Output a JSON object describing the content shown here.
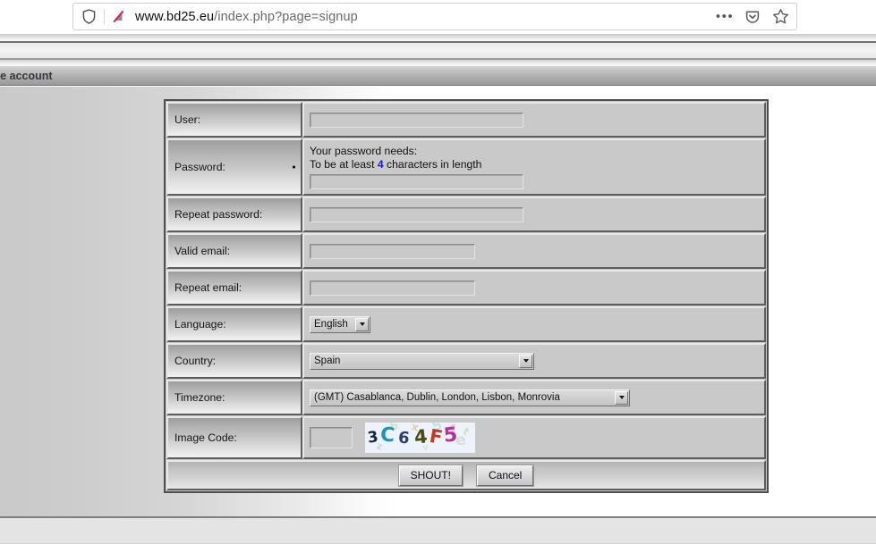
{
  "browser": {
    "url_domain": "www.bd25.eu",
    "url_path": "/index.php?page=signup",
    "url_full": "www.bd25.eu/index.php?page=signup",
    "icons": {
      "shield": "shield-icon",
      "permission_blocked": "blocked-permission-icon",
      "more": "ellipsis-icon",
      "pocket": "pocket-save-icon",
      "bookmark": "star-bookmark-icon"
    },
    "dots_glyph": "•••"
  },
  "page": {
    "header_title": "te account"
  },
  "form": {
    "rows": [
      {
        "label": "User:",
        "type": "text",
        "value": "",
        "required": false
      },
      {
        "label": "Password:",
        "type": "password_hint",
        "value": "",
        "required": true
      },
      {
        "label": "Repeat password:",
        "type": "text",
        "value": "",
        "required": false
      },
      {
        "label": "Valid email:",
        "type": "text",
        "value": "",
        "required": false
      },
      {
        "label": "Repeat email:",
        "type": "text",
        "value": "",
        "required": false
      },
      {
        "label": "Language:",
        "type": "select",
        "value": "English",
        "required": false
      },
      {
        "label": "Country:",
        "type": "select",
        "value": "Spain",
        "required": false
      },
      {
        "label": "Timezone:",
        "type": "select",
        "value": "(GMT) Casablanca, Dublin, London, Lisbon, Monrovia",
        "required": false
      },
      {
        "label": "Image Code:",
        "type": "captcha",
        "value": "",
        "required": false
      }
    ],
    "password_hint": {
      "line1": "Your password needs:",
      "line2_before": "To be at least ",
      "line2_number": "4",
      "line2_after": " characters in length"
    },
    "labels": {
      "user": "User:",
      "password": "Password:",
      "repeat_password": "Repeat password:",
      "valid_email": "Valid email:",
      "repeat_email": "Repeat email:",
      "language": "Language:",
      "country": "Country:",
      "timezone": "Timezone:",
      "image_code": "Image Code:"
    },
    "values": {
      "user": "",
      "password": "",
      "repeat_password": "",
      "valid_email": "",
      "repeat_email": "",
      "language": "English",
      "country": "Spain",
      "timezone": "(GMT) Casablanca, Dublin, London, Lisbon, Monrovia",
      "image_code": ""
    },
    "captcha": {
      "text": "3C64F5",
      "characters": [
        {
          "ch": "3",
          "color": "#15254a"
        },
        {
          "ch": "C",
          "color": "#1e93b8"
        },
        {
          "ch": "6",
          "color": "#2d3f6e"
        },
        {
          "ch": "4",
          "color": "#4a4a14"
        },
        {
          "ch": "F",
          "color": "#c0392b"
        },
        {
          "ch": "5",
          "color": "#b0339e"
        }
      ],
      "background": "#eef3fb"
    },
    "buttons": {
      "submit": "SHOUT!",
      "cancel": "Cancel"
    }
  },
  "colors": {
    "table_border": "#4f4f4f",
    "cell_bg": "#c9c9c9",
    "hint_number": "#1a1ad6",
    "page_header_text": "#37373d"
  }
}
